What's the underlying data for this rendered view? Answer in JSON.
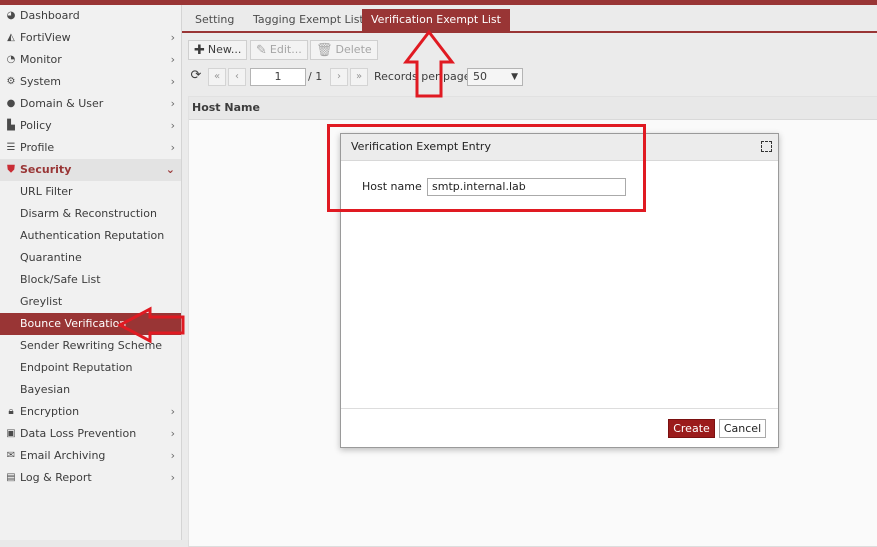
{
  "sidebar": {
    "items": [
      {
        "label": "Dashboard",
        "icon": "dashboard-icon",
        "chev": ""
      },
      {
        "label": "FortiView",
        "icon": "chart-icon",
        "chev": "›"
      },
      {
        "label": "Monitor",
        "icon": "monitor-pie-icon",
        "chev": "›"
      },
      {
        "label": "System",
        "icon": "gear-icon",
        "chev": "›"
      },
      {
        "label": "Domain & User",
        "icon": "user-icon",
        "chev": "›"
      },
      {
        "label": "Policy",
        "icon": "policy-icon",
        "chev": "›"
      },
      {
        "label": "Profile",
        "icon": "list-icon",
        "chev": "›"
      },
      {
        "label": "Security",
        "icon": "shield-icon",
        "chev": "⌄"
      },
      {
        "label": "URL Filter"
      },
      {
        "label": "Disarm & Reconstruction"
      },
      {
        "label": "Authentication Reputation"
      },
      {
        "label": "Quarantine"
      },
      {
        "label": "Block/Safe List"
      },
      {
        "label": "Greylist"
      },
      {
        "label": "Bounce Verification"
      },
      {
        "label": "Sender Rewriting Scheme"
      },
      {
        "label": "Endpoint Reputation"
      },
      {
        "label": "Bayesian"
      },
      {
        "label": "Encryption",
        "icon": "lock-icon",
        "chev": "›"
      },
      {
        "label": "Data Loss Prevention",
        "icon": "dlp-icon",
        "chev": "›"
      },
      {
        "label": "Email Archiving",
        "icon": "mail-icon",
        "chev": "›"
      },
      {
        "label": "Log & Report",
        "icon": "log-icon",
        "chev": "›"
      }
    ]
  },
  "tabs": [
    "Setting",
    "Tagging Exempt List",
    "Verification Exempt List"
  ],
  "toolbar": {
    "new": "New...",
    "edit": "Edit...",
    "delete": "Delete"
  },
  "pager": {
    "page": "1",
    "of": "/ 1",
    "records_label": "Records per page",
    "per_page": "50"
  },
  "grid": {
    "column": "Host Name"
  },
  "dialog": {
    "title": "Verification Exempt Entry",
    "host_label": "Host name",
    "host_value": "smtp.internal.lab",
    "create": "Create",
    "cancel": "Cancel"
  },
  "colors": {
    "accent": "#8b1a1a",
    "annotation": "#e01a22"
  }
}
